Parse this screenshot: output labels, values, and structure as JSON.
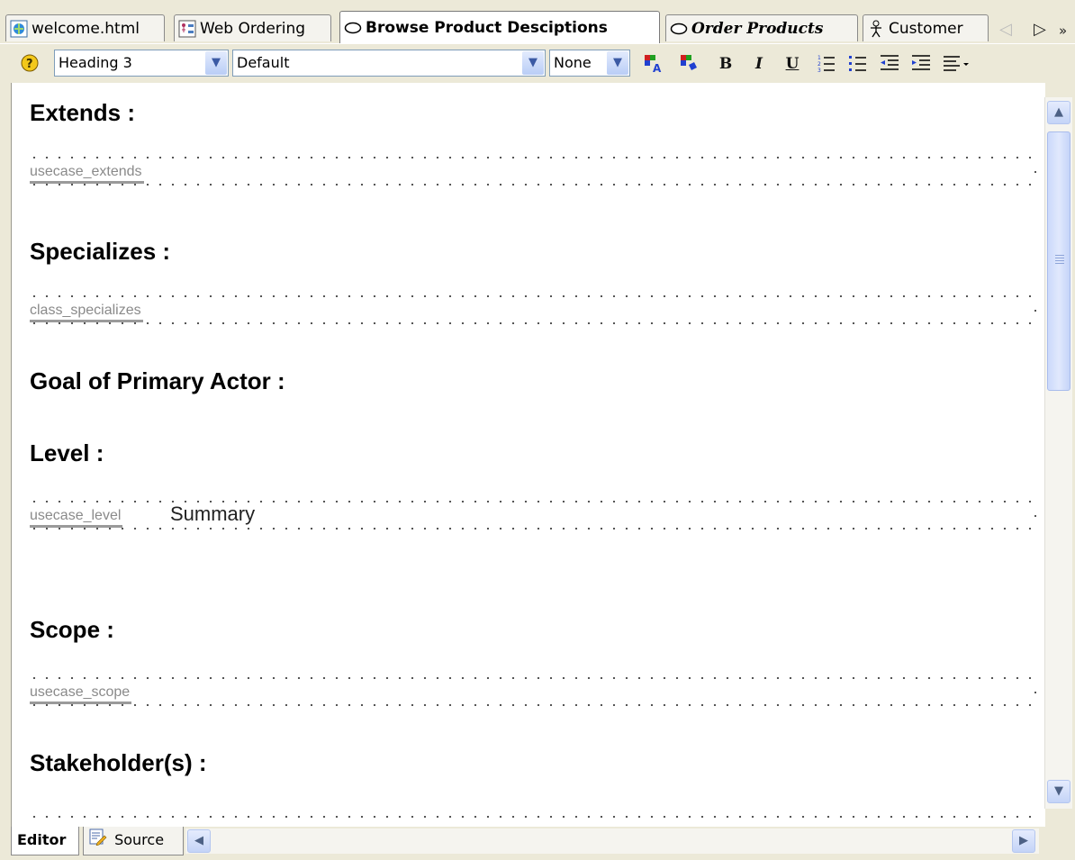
{
  "tabs": [
    {
      "label": "welcome.html",
      "icon": "html-page-icon",
      "active": false
    },
    {
      "label": "Web Ordering",
      "icon": "diagram-icon",
      "active": false
    },
    {
      "label": "Browse Product Desciptions",
      "icon": "usecase-ellipse-icon",
      "active": true
    },
    {
      "label": "Order Products",
      "icon": "usecase-ellipse-icon",
      "active": false
    },
    {
      "label": "Customer",
      "icon": "actor-icon",
      "active": false
    }
  ],
  "toolbar": {
    "style_value": "Heading 3",
    "font_value": "Default",
    "size_value": "None",
    "buttons": [
      "text-color-icon",
      "highlight-color-icon",
      "bold-icon",
      "italic-icon",
      "underline-icon",
      "numbered-list-icon",
      "bulleted-list-icon",
      "outdent-icon",
      "indent-icon",
      "align-icon"
    ],
    "bold_glyph": "B",
    "italic_glyph": "I",
    "underline_glyph": "U"
  },
  "document": {
    "sections": [
      {
        "heading": "Extends :",
        "field": {
          "tag": "usecase_extends",
          "value": ""
        }
      },
      {
        "heading": "Specializes :",
        "field": {
          "tag": "class_specializes",
          "value": ""
        }
      },
      {
        "heading": "Goal of Primary Actor :"
      },
      {
        "heading": "Level :",
        "field": {
          "tag": "usecase_level",
          "value": "Summary"
        }
      },
      {
        "heading": "Scope :",
        "field": {
          "tag": "usecase_scope",
          "value": ""
        }
      },
      {
        "heading": "Stakeholder(s) :"
      }
    ]
  },
  "bottom_tabs": [
    {
      "label": "Editor",
      "active": true
    },
    {
      "label": "Source",
      "icon": "source-edit-icon",
      "active": false
    }
  ],
  "colors": {
    "chrome": "#ece9d8",
    "scroll_accent": "#c4d4f7",
    "placeholder_text": "#8a8a8a"
  }
}
